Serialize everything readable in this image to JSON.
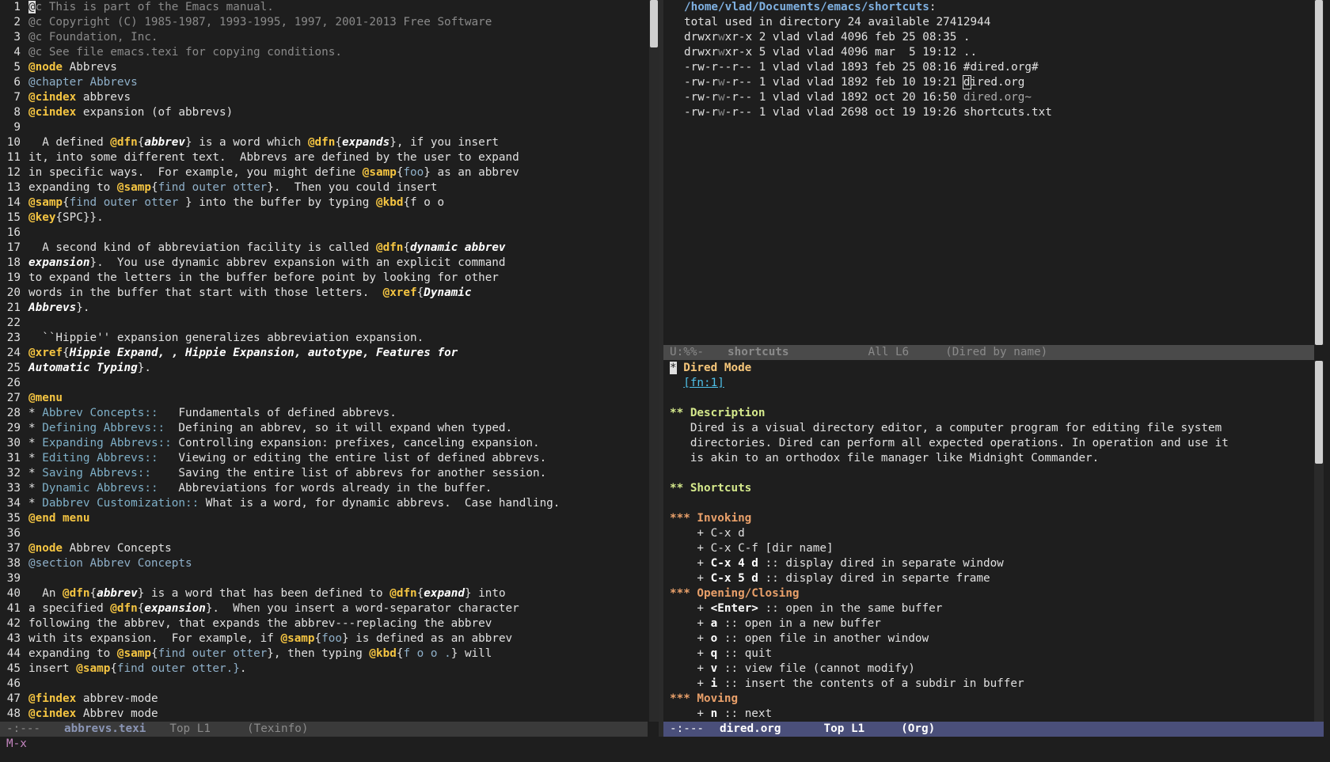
{
  "left_buffer": {
    "lines": [
      [
        [
          "cur",
          "@"
        ],
        [
          "cmt",
          "c This is part of the Emacs manual."
        ]
      ],
      [
        [
          "cmt",
          "@c Copyright (C) 1985-1987, 1993-1995, 1997, 2001-2013 Free Software"
        ]
      ],
      [
        [
          "cmt",
          "@c Foundation, Inc."
        ]
      ],
      [
        [
          "cmt",
          "@c See file emacs.texi for copying conditions."
        ]
      ],
      [
        [
          "kw",
          "@node"
        ],
        [
          "t",
          " Abbrevs"
        ]
      ],
      [
        [
          "arg",
          "@chapter Abbrevs"
        ]
      ],
      [
        [
          "kw",
          "@cindex"
        ],
        [
          "t",
          " abbrevs"
        ]
      ],
      [
        [
          "kw",
          "@cindex"
        ],
        [
          "t",
          " expansion (of abbrevs)"
        ]
      ],
      [],
      [
        [
          "t",
          "  A defined "
        ],
        [
          "kw",
          "@dfn"
        ],
        [
          "t",
          "{"
        ],
        [
          "em",
          "abbrev"
        ],
        [
          "t",
          "} is a word which "
        ],
        [
          "kw",
          "@dfn"
        ],
        [
          "t",
          "{"
        ],
        [
          "em",
          "expands"
        ],
        [
          "t",
          "}, if you insert"
        ]
      ],
      [
        [
          "t",
          "it, into some different text.  Abbrevs are defined by the user to expand"
        ]
      ],
      [
        [
          "t",
          "in specific ways.  For example, you might define "
        ],
        [
          "kw",
          "@samp"
        ],
        [
          "t",
          "{"
        ],
        [
          "arg",
          "foo"
        ],
        [
          "t",
          "} as an abbrev"
        ]
      ],
      [
        [
          "t",
          "expanding to "
        ],
        [
          "kw",
          "@samp"
        ],
        [
          "t",
          "{"
        ],
        [
          "arg",
          "find outer otter"
        ],
        [
          "t",
          "}.  Then you could insert"
        ]
      ],
      [
        [
          "kw",
          "@samp"
        ],
        [
          "t",
          "{"
        ],
        [
          "arg",
          "find outer otter "
        ],
        [
          "t",
          "} into the buffer by typing "
        ],
        [
          "kw",
          "@kbd"
        ],
        [
          "t",
          "{f o o"
        ]
      ],
      [
        [
          "kw",
          "@key"
        ],
        [
          "t",
          "{SPC}}."
        ]
      ],
      [],
      [
        [
          "t",
          "  A second kind of abbreviation facility is called "
        ],
        [
          "kw",
          "@dfn"
        ],
        [
          "t",
          "{"
        ],
        [
          "em",
          "dynamic abbrev"
        ]
      ],
      [
        [
          "em",
          "expansion"
        ],
        [
          "t",
          "}.  You use dynamic abbrev expansion with an explicit command"
        ]
      ],
      [
        [
          "t",
          "to expand the letters in the buffer before point by looking for other"
        ]
      ],
      [
        [
          "t",
          "words in the buffer that start with those letters.  "
        ],
        [
          "kw",
          "@xref"
        ],
        [
          "t",
          "{"
        ],
        [
          "em",
          "Dynamic"
        ]
      ],
      [
        [
          "em",
          "Abbrevs"
        ],
        [
          "t",
          "}."
        ]
      ],
      [],
      [
        [
          "t",
          "  ``Hippie'' expansion generalizes abbreviation expansion."
        ]
      ],
      [
        [
          "kw",
          "@xref"
        ],
        [
          "t",
          "{"
        ],
        [
          "em",
          "Hippie Expand, , Hippie Expansion, autotype, Features for"
        ]
      ],
      [
        [
          "em",
          "Automatic Typing"
        ],
        [
          "t",
          "}."
        ]
      ],
      [],
      [
        [
          "kw",
          "@menu"
        ]
      ],
      [
        [
          "t",
          "* "
        ],
        [
          "link",
          "Abbrev Concepts::"
        ],
        [
          "t",
          "   Fundamentals of defined abbrevs."
        ]
      ],
      [
        [
          "t",
          "* "
        ],
        [
          "link",
          "Defining Abbrevs::"
        ],
        [
          "t",
          "  Defining an abbrev, so it will expand when typed."
        ]
      ],
      [
        [
          "t",
          "* "
        ],
        [
          "link",
          "Expanding Abbrevs::"
        ],
        [
          "t",
          " Controlling expansion: prefixes, canceling expansion."
        ]
      ],
      [
        [
          "t",
          "* "
        ],
        [
          "link",
          "Editing Abbrevs::"
        ],
        [
          "t",
          "   Viewing or editing the entire list of defined abbrevs."
        ]
      ],
      [
        [
          "t",
          "* "
        ],
        [
          "link",
          "Saving Abbrevs::"
        ],
        [
          "t",
          "    Saving the entire list of abbrevs for another session."
        ]
      ],
      [
        [
          "t",
          "* "
        ],
        [
          "link",
          "Dynamic Abbrevs::"
        ],
        [
          "t",
          "   Abbreviations for words already in the buffer."
        ]
      ],
      [
        [
          "t",
          "* "
        ],
        [
          "link",
          "Dabbrev Customization::"
        ],
        [
          "t",
          " What is a word, for dynamic abbrevs.  Case handling."
        ]
      ],
      [
        [
          "kw",
          "@end menu"
        ]
      ],
      [],
      [
        [
          "kw",
          "@node"
        ],
        [
          "t",
          " Abbrev Concepts"
        ]
      ],
      [
        [
          "arg",
          "@section Abbrev Concepts"
        ]
      ],
      [],
      [
        [
          "t",
          "  An "
        ],
        [
          "kw",
          "@dfn"
        ],
        [
          "t",
          "{"
        ],
        [
          "em",
          "abbrev"
        ],
        [
          "t",
          "} is a word that has been defined to "
        ],
        [
          "kw",
          "@dfn"
        ],
        [
          "t",
          "{"
        ],
        [
          "em",
          "expand"
        ],
        [
          "t",
          "} into"
        ]
      ],
      [
        [
          "t",
          "a specified "
        ],
        [
          "kw",
          "@dfn"
        ],
        [
          "t",
          "{"
        ],
        [
          "em",
          "expansion"
        ],
        [
          "t",
          "}.  When you insert a word-separator character"
        ]
      ],
      [
        [
          "t",
          "following the abbrev, that expands the abbrev---replacing the abbrev"
        ]
      ],
      [
        [
          "t",
          "with its expansion.  For example, if "
        ],
        [
          "kw",
          "@samp"
        ],
        [
          "t",
          "{"
        ],
        [
          "arg",
          "foo"
        ],
        [
          "t",
          "} is defined as an abbrev"
        ]
      ],
      [
        [
          "t",
          "expanding to "
        ],
        [
          "kw",
          "@samp"
        ],
        [
          "t",
          "{"
        ],
        [
          "arg",
          "find outer otter"
        ],
        [
          "t",
          "}, then typing "
        ],
        [
          "kw",
          "@kbd"
        ],
        [
          "t",
          "{"
        ],
        [
          "arg",
          "f o o ."
        ],
        [
          "t",
          "} will"
        ]
      ],
      [
        [
          "t",
          "insert "
        ],
        [
          "kw",
          "@samp"
        ],
        [
          "t",
          "{"
        ],
        [
          "arg",
          "find outer otter.}"
        ],
        [
          "t",
          "."
        ]
      ],
      [],
      [
        [
          "kw",
          "@findex"
        ],
        [
          "t",
          " abbrev-mode"
        ]
      ],
      [
        [
          "kw",
          "@cindex"
        ],
        [
          "t",
          " Abbrev mode"
        ]
      ]
    ]
  },
  "right_top_buffer": {
    "lines": [
      [
        [
          "dir",
          "/home/vlad/Documents/emacs/shortcuts"
        ],
        [
          "t",
          ":"
        ]
      ],
      [
        [
          "t",
          "total used in directory 24 available 27412944"
        ]
      ],
      [
        [
          "t",
          "drwxr"
        ],
        [
          "pw",
          "w"
        ],
        [
          "t",
          "xr-x 2 vlad vlad 4096 feb 25 08:35 ."
        ]
      ],
      [
        [
          "t",
          "drwxr"
        ],
        [
          "pw",
          "w"
        ],
        [
          "t",
          "xr-x 5 vlad vlad 4096 mar  5 19:12 .."
        ]
      ],
      [
        [
          "t",
          "-rw-r--r-- 1 vlad vlad 1893 feb 25 08:16 #dired.org#"
        ]
      ],
      [
        [
          "t",
          "-rw-r"
        ],
        [
          "pw",
          "w"
        ],
        [
          "t",
          "-r-- 1 vlad vlad 1892 feb 10 19:21 "
        ],
        [
          "curo",
          "d"
        ],
        [
          "t",
          "ired.org"
        ]
      ],
      [
        [
          "t",
          "-rw-r"
        ],
        [
          "pw",
          "w"
        ],
        [
          "t",
          "-r-- 1 vlad vlad 1892 oct 20 16:50 "
        ],
        [
          "dim",
          "dired.org~"
        ]
      ],
      [
        [
          "t",
          "-rw-r"
        ],
        [
          "pw",
          "w"
        ],
        [
          "t",
          "-r-- 1 vlad vlad 2698 oct 19 19:26 shortcuts.txt"
        ]
      ]
    ]
  },
  "right_bottom_buffer": {
    "lines": [
      [
        [
          "cur",
          "*"
        ],
        [
          "h1",
          " Dired Mode"
        ]
      ],
      [
        [
          "t",
          "  "
        ],
        [
          "fn",
          "[fn:1]"
        ]
      ],
      [],
      [
        [
          "h2",
          "** Description"
        ]
      ],
      [
        [
          "t",
          "   Dired is a visual directory editor, a computer program for editing file system"
        ]
      ],
      [
        [
          "t",
          "   directories. Dired can perform all expected operations. In operation and use it"
        ]
      ],
      [
        [
          "t",
          "   is akin to an orthodox file manager like Midnight Commander."
        ]
      ],
      [],
      [
        [
          "h2",
          "** Shortcuts"
        ]
      ],
      [],
      [
        [
          "h3",
          "*** Invoking"
        ]
      ],
      [
        [
          "t",
          "    + C-x d"
        ]
      ],
      [
        [
          "t",
          "    + C-x C-f [dir name]"
        ]
      ],
      [
        [
          "t",
          "    + "
        ],
        [
          "b",
          "C-x 4 d"
        ],
        [
          "t",
          " :: display dired in separate window"
        ]
      ],
      [
        [
          "t",
          "    + "
        ],
        [
          "b",
          "C-x 5 d"
        ],
        [
          "t",
          " :: display dired in separte frame"
        ]
      ],
      [
        [
          "h3",
          "*** Opening/Closing"
        ]
      ],
      [
        [
          "t",
          "    + "
        ],
        [
          "b",
          "<Enter>"
        ],
        [
          "t",
          " :: open in the same buffer"
        ]
      ],
      [
        [
          "t",
          "    + "
        ],
        [
          "b",
          "a"
        ],
        [
          "t",
          " :: open in a new buffer"
        ]
      ],
      [
        [
          "t",
          "    + "
        ],
        [
          "b",
          "o"
        ],
        [
          "t",
          " :: open file in another window"
        ]
      ],
      [
        [
          "t",
          "    + "
        ],
        [
          "b",
          "q"
        ],
        [
          "t",
          " :: quit"
        ]
      ],
      [
        [
          "t",
          "    + "
        ],
        [
          "b",
          "v"
        ],
        [
          "t",
          " :: view file (cannot modify)"
        ]
      ],
      [
        [
          "t",
          "    + "
        ],
        [
          "b",
          "i"
        ],
        [
          "t",
          " :: insert the contents of a subdir in buffer"
        ]
      ],
      [
        [
          "h3",
          "*** Moving"
        ]
      ],
      [
        [
          "t",
          "    + "
        ],
        [
          "b",
          "n"
        ],
        [
          "t",
          " :: next"
        ]
      ]
    ]
  },
  "modeline_left": {
    "status": "-:---",
    "buffer": "abbrevs.texi",
    "position": "Top L1",
    "mode": "(Texinfo)"
  },
  "modeline_right_top": {
    "status": "U:%%-",
    "buffer": "shortcuts",
    "position": "All L6",
    "mode": "(Dired by name)"
  },
  "modeline_right_bottom": {
    "status": "-:---",
    "buffer": "dired.org",
    "position": "Top L1",
    "mode": "(Org)"
  },
  "minibuffer": {
    "prompt": "M-x"
  },
  "colors": {
    "background": "#1e1e1e",
    "keyword": "#f5c542",
    "comment": "#8a8a8a",
    "active_modeline": "#4a4f7a"
  }
}
